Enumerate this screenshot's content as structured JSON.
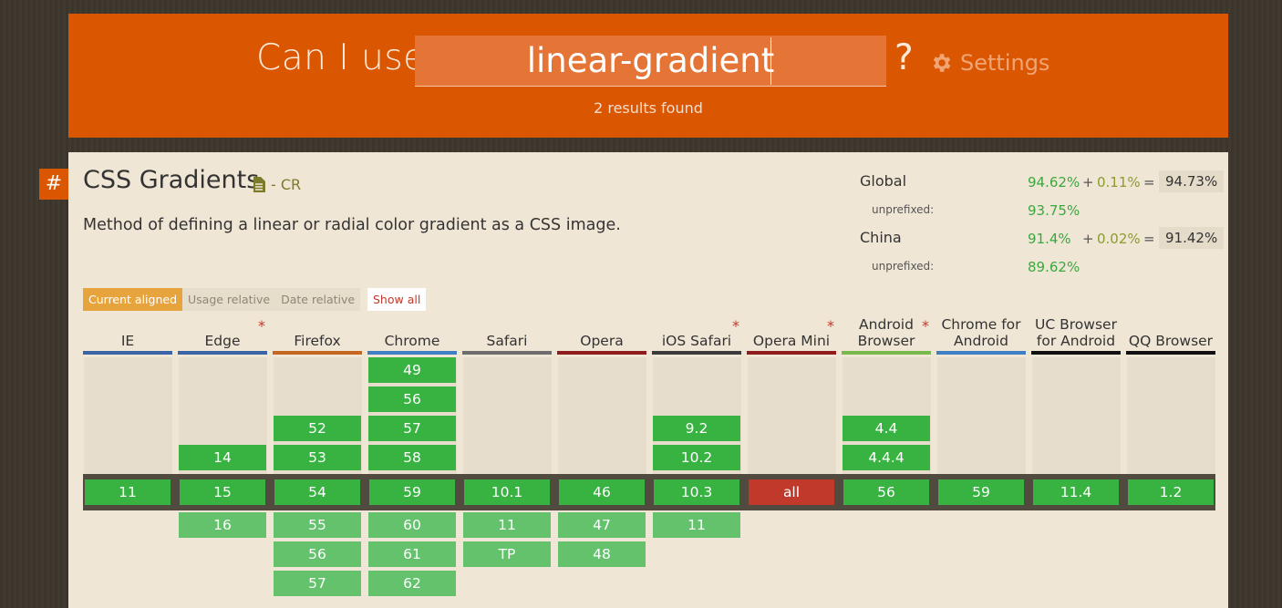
{
  "header": {
    "title": "Can I use",
    "search_value": "linear-gradient",
    "question": "?",
    "settings_label": "Settings",
    "results": "2 results found"
  },
  "feature": {
    "hash": "#",
    "title": "CSS Gradients",
    "status": "- CR",
    "description": "Method of defining a linear or radial color gradient as a CSS image."
  },
  "stats": {
    "global_label": "Global",
    "global_prefixed": "94.62%",
    "global_plus": "+",
    "global_partial": "0.11%",
    "global_eq": "=",
    "global_total": "94.73%",
    "global_unprefixed_label": "unprefixed:",
    "global_unprefixed": "93.75%",
    "china_label": "China",
    "china_prefixed": "91.4%",
    "china_plus": "+",
    "china_partial": "0.02%",
    "china_eq": "=",
    "china_total": "91.42%",
    "china_unprefixed_label": "unprefixed:",
    "china_unprefixed": "89.62%"
  },
  "view_tabs": {
    "current": "Current aligned",
    "usage": "Usage relative",
    "date": "Date relative",
    "show_all": "Show all"
  },
  "browsers": [
    {
      "name": "IE",
      "asterisk": "",
      "bar": "#3a64a6"
    },
    {
      "name": "Edge",
      "asterisk": "*",
      "bar": "#3a64a6"
    },
    {
      "name": "Firefox",
      "asterisk": "",
      "bar": "#c4661f"
    },
    {
      "name": "Chrome",
      "asterisk": "",
      "bar": "#3f7fc4"
    },
    {
      "name": "Safari",
      "asterisk": "",
      "bar": "#6d6d6d"
    },
    {
      "name": "Opera",
      "asterisk": "",
      "bar": "#8e1c1c"
    },
    {
      "name": "iOS Safari",
      "asterisk": "*",
      "bar": "#3a3a3a"
    },
    {
      "name": "Opera Mini",
      "asterisk": "*",
      "bar": "#8e1c1c"
    },
    {
      "name": "Android Browser",
      "asterisk": "*",
      "bar": "#79b84a"
    },
    {
      "name": "Chrome for Android",
      "asterisk": "",
      "bar": "#3f7fc4"
    },
    {
      "name": "UC Browser for Android",
      "asterisk": "",
      "bar": "#111111"
    },
    {
      "name": "QQ Browser",
      "asterisk": "",
      "bar": "#111111"
    }
  ],
  "versions": {
    "past": [
      [],
      [
        "14"
      ],
      [
        "52",
        "53"
      ],
      [
        "49",
        "56",
        "57",
        "58"
      ],
      [],
      [],
      [
        "9.2",
        "10.2"
      ],
      [],
      [
        "4.4",
        "4.4.4"
      ],
      [],
      [],
      []
    ],
    "current": [
      "11",
      "15",
      "54",
      "59",
      "10.1",
      "46",
      "10.3",
      "all",
      "56",
      "59",
      "11.4",
      "1.2"
    ],
    "current_unsupported": [
      false,
      false,
      false,
      false,
      false,
      false,
      false,
      true,
      false,
      false,
      false,
      false
    ],
    "future": [
      [],
      [
        "16"
      ],
      [
        "55",
        "56",
        "57"
      ],
      [
        "60",
        "61",
        "62"
      ],
      [
        "11",
        "TP"
      ],
      [
        "47",
        "48"
      ],
      [
        "11"
      ],
      [],
      [],
      [],
      [],
      []
    ]
  },
  "colors": {
    "header_orange": "#db5600",
    "supported": "#38b341",
    "supported_future": "#63c26b",
    "unsupported": "#c0392b"
  }
}
